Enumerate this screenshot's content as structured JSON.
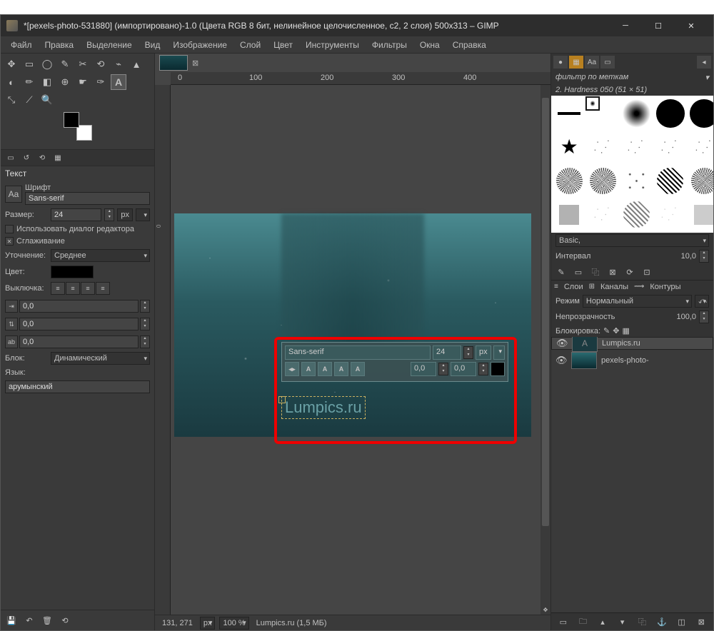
{
  "title": "*[pexels-photo-531880] (импортировано)-1.0 (Цвета RGB 8 бит, нелинейное целочисленное, с2, 2 слоя) 500x313 – GIMP",
  "menu": [
    "Файл",
    "Правка",
    "Выделение",
    "Вид",
    "Изображение",
    "Слой",
    "Цвет",
    "Инструменты",
    "Фильтры",
    "Окна",
    "Справка"
  ],
  "toolOptions": {
    "title": "Текст",
    "fontLabel": "Шрифт",
    "font": "Sans-serif",
    "sizeLabel": "Размер:",
    "size": "24",
    "unit": "px",
    "useEditorDialog": "Использовать диалог редактора",
    "antialias": "Сглаживание",
    "hintLabel": "Уточнение:",
    "hintValue": "Среднее",
    "colorLabel": "Цвет:",
    "justifyLabel": "Выключка:",
    "indent": "0,0",
    "lineSpacing": "0,0",
    "letterSpacing": "0,0",
    "boxLabel": "Блок:",
    "boxValue": "Динамический",
    "langLabel": "Язык:",
    "langValue": "арумынский"
  },
  "floatEditor": {
    "font": "Sans-serif",
    "size": "24",
    "unit": "px",
    "val1": "0,0",
    "val2": "0,0"
  },
  "textContent": "Lumpics.ru",
  "statusbar": {
    "coords": "131, 271",
    "unit": "px",
    "zoom": "100 %",
    "info": "Lumpics.ru (1,5 МБ)"
  },
  "rightPanel": {
    "filterPlaceholder": "фильтр по меткам",
    "brushInfo": "2. Hardness 050 (51 × 51)",
    "preset": "Basic,",
    "intervalLabel": "Интервал",
    "intervalValue": "10,0",
    "layerTabs": [
      "Слои",
      "Каналы",
      "Контуры"
    ],
    "modeLabel": "Режим",
    "modeValue": "Нормальный",
    "opacityLabel": "Непрозрачность",
    "opacityValue": "100,0",
    "lockLabel": "Блокировка:",
    "layers": [
      {
        "name": "Lumpics.ru",
        "text": true
      },
      {
        "name": "pexels-photo-",
        "text": false
      }
    ]
  },
  "ruler": {
    "h": [
      "0",
      "100",
      "200",
      "300",
      "400"
    ],
    "v": [
      "0"
    ]
  }
}
